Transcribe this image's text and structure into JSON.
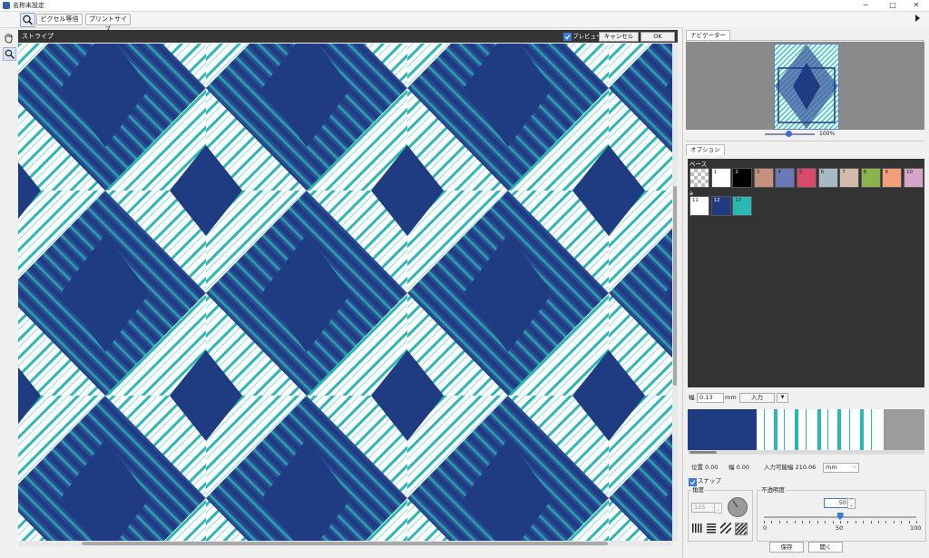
{
  "window": {
    "title": "名称未設定",
    "minimize": "─",
    "maximize": "□",
    "close": "✕"
  },
  "toolbar": {
    "pixel_equal": "ピクセル等倍",
    "print_size": "プリントサイズ"
  },
  "canvas_header": {
    "title": "ストライプ",
    "preview_label": "プレビュー",
    "preview_checked": true,
    "cancel": "キャンセル",
    "ok": "OK"
  },
  "navigator": {
    "tab": "ナビゲーター",
    "zoom": "100%"
  },
  "options": {
    "tab": "オプション"
  },
  "palette": {
    "base_label": "ベース",
    "base_swatches": [
      {
        "num": "",
        "color": "checker"
      },
      {
        "num": "1",
        "color": "#ffffff"
      },
      {
        "num": "2",
        "color": "#000000"
      },
      {
        "num": "3",
        "color": "#c49080"
      },
      {
        "num": "4",
        "color": "#6a7ab8"
      },
      {
        "num": "5",
        "color": "#d84a6a"
      },
      {
        "num": "6",
        "color": "#a9b9c3"
      },
      {
        "num": "7",
        "color": "#d2bca9"
      },
      {
        "num": "8",
        "color": "#8ab34f"
      },
      {
        "num": "9",
        "color": "#f2a07a"
      },
      {
        "num": "10",
        "color": "#d6a4c8"
      }
    ],
    "row2_label": "a",
    "row2_swatches": [
      {
        "num": "11",
        "color": "#ffffff"
      },
      {
        "num": "12",
        "color": "#1f3b82"
      },
      {
        "num": "13",
        "color": "#2ab8b4"
      }
    ]
  },
  "width_row": {
    "label": "幅",
    "value": "0.13",
    "unit": "mm",
    "input_button": "入力",
    "dropdown": "▼"
  },
  "position_row": {
    "position": "位置 0.00",
    "width": "幅 0.00",
    "available": "入力可能幅 210.06",
    "unit": "mm"
  },
  "snap": {
    "label": "スナップ",
    "checked": true
  },
  "angle": {
    "label": "角度",
    "value": "125"
  },
  "opacity": {
    "label": "不透明度",
    "value": "50",
    "min": "0",
    "mid": "50",
    "max": "100",
    "level": 50
  },
  "buttons": {
    "save": "保存",
    "open": "開く"
  },
  "colors": {
    "navy": "#1f3b82",
    "teal": "#2ab8b4",
    "dark": "#333333"
  }
}
